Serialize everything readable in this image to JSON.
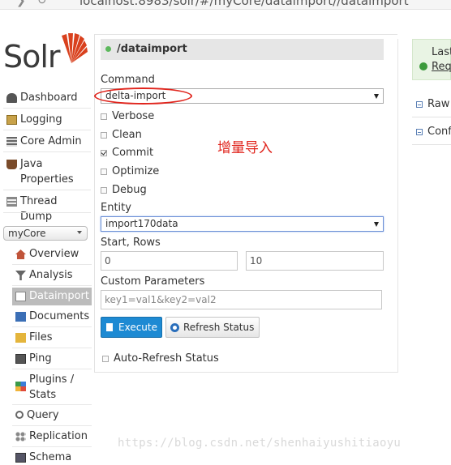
{
  "browser": {
    "url": "localhost:8983/solr/#/myCore/dataimport//dataimport"
  },
  "logo": {
    "text": "Solr"
  },
  "nav": {
    "items": [
      {
        "label": "Dashboard",
        "icon": "dashboard-icon"
      },
      {
        "label": "Logging",
        "icon": "logging-icon"
      },
      {
        "label": "Core Admin",
        "icon": "core-admin-icon"
      },
      {
        "label": "Java\nProperties",
        "icon": "java-icon"
      },
      {
        "label": "Thread Dump",
        "icon": "thread-dump-icon"
      }
    ],
    "core_selector": "myCore",
    "core_items": [
      {
        "label": "Overview",
        "icon": "home-icon"
      },
      {
        "label": "Analysis",
        "icon": "filter-icon"
      },
      {
        "label": "Dataimport",
        "icon": "dataimport-icon",
        "active": true
      },
      {
        "label": "Documents",
        "icon": "documents-icon"
      },
      {
        "label": "Files",
        "icon": "folder-icon"
      },
      {
        "label": "Ping",
        "icon": "ping-icon"
      },
      {
        "label": "Plugins /\nStats",
        "icon": "plugins-icon"
      },
      {
        "label": "Query",
        "icon": "query-icon"
      },
      {
        "label": "Replication",
        "icon": "replication-icon"
      },
      {
        "label": "Schema",
        "icon": "schema-icon"
      }
    ]
  },
  "panel": {
    "title": "/dataimport",
    "command_label": "Command",
    "command_value": "delta-import",
    "options": [
      {
        "label": "Verbose",
        "checked": false
      },
      {
        "label": "Clean",
        "checked": false
      },
      {
        "label": "Commit",
        "checked": true
      },
      {
        "label": "Optimize",
        "checked": false
      },
      {
        "label": "Debug",
        "checked": false
      }
    ],
    "entity_label": "Entity",
    "entity_value": "import170data",
    "start_rows_label": "Start, Rows",
    "start_value": "0",
    "rows_value": "10",
    "custom_params_label": "Custom Parameters",
    "custom_params_placeholder": "key1=val1&key2=val2",
    "execute_label": "Execute",
    "refresh_label": "Refresh Status",
    "auto_refresh_label": "Auto-Refresh Status"
  },
  "annotation": {
    "text": "增量导入"
  },
  "status": {
    "last_label": "Last",
    "request_label": "Requ",
    "raw_label": "Raw",
    "config_label": "Confi"
  },
  "watermark": "https://blog.csdn.net/shenhaiyushitiaoyu",
  "colors": {
    "accent": "#1d8ad3",
    "annotation": "#e0241c",
    "success": "#5cb85c"
  }
}
